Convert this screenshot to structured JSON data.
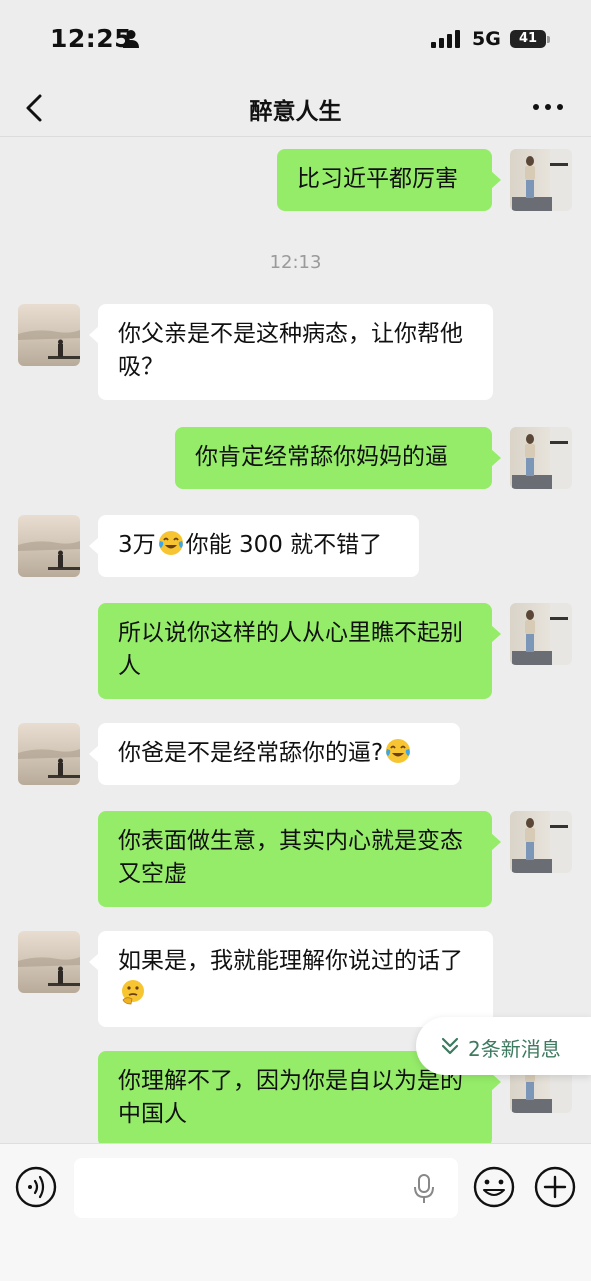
{
  "status_bar": {
    "time": "12:25",
    "network": "5G",
    "battery": "41"
  },
  "header": {
    "title": "醉意人生"
  },
  "messages": [
    {
      "from": "self",
      "text": "比习近平都厉害"
    },
    {
      "type": "time",
      "text": "12:13"
    },
    {
      "from": "contact",
      "text": "你父亲是不是这种病态，让你帮他吸？"
    },
    {
      "from": "self",
      "text": "你肯定经常舔你妈妈的逼"
    },
    {
      "from": "contact",
      "text_a": "3万",
      "emoji": "crying-laughing",
      "text_b": "你能 300 就不错了"
    },
    {
      "from": "self",
      "text": "所以说你这样的人从心里瞧不起别人"
    },
    {
      "from": "contact",
      "text_a": "你爸是不是经常舔你的逼?",
      "emoji": "crying-laughing"
    },
    {
      "from": "self",
      "text": "你表面做生意，其实内心就是变态又空虚"
    },
    {
      "from": "contact",
      "text_a": "如果是，我就能理解你说过的话了",
      "emoji": "thinking-face"
    },
    {
      "from": "self",
      "text": "你理解不了，因为你是自以为是的中国人"
    }
  ],
  "new_messages_pill": {
    "label": "2条新消息"
  },
  "input_bar": {
    "placeholder": ""
  },
  "colors": {
    "self_bubble": "#95ec69",
    "contact_bubble": "#ffffff",
    "background": "#ededed",
    "pill_text": "#3d7a5f"
  }
}
